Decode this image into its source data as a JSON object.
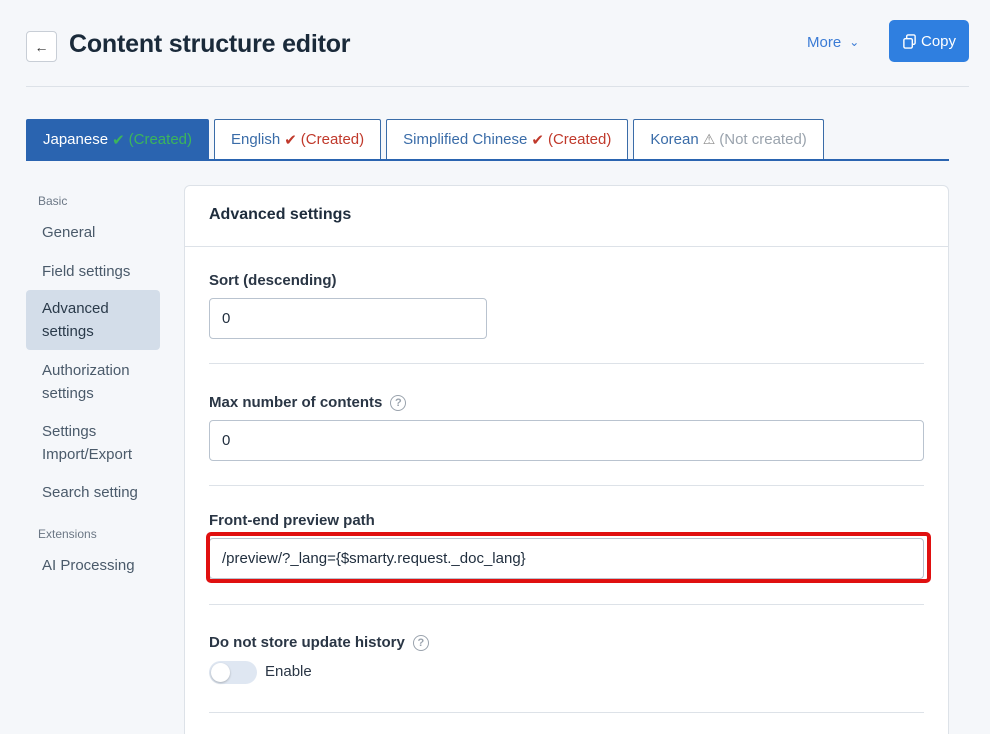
{
  "header": {
    "back_icon": "arrow-left-icon",
    "title": "Content structure editor",
    "more_label": "More",
    "copy_label": "Copy",
    "copy_icon": "copy-icon"
  },
  "tabs": [
    {
      "lang": "Japanese",
      "mark": "✔",
      "status": "(Created)",
      "active": true
    },
    {
      "lang": "English",
      "mark": "✔",
      "status": "(Created)",
      "active": false
    },
    {
      "lang": "Simplified Chinese",
      "mark": "✔",
      "status": "(Created)",
      "active": false
    },
    {
      "lang": "Korean",
      "mark": "⚠",
      "status": "(Not created)",
      "active": false
    }
  ],
  "sidebar": {
    "section_basic": "Basic",
    "items": [
      "General",
      "Field settings",
      "Advanced settings",
      "Authorization settings",
      "Settings Import/Export",
      "Search setting"
    ],
    "section_extensions": "Extensions",
    "ext_items": [
      "AI Processing"
    ]
  },
  "panel": {
    "title": "Advanced settings",
    "sort_label": "Sort (descending)",
    "sort_value": "0",
    "max_label": "Max number of contents",
    "max_value": "0",
    "preview_label": "Front-end preview path",
    "preview_value": "/preview/?_lang={$smarty.request._doc_lang}",
    "history_label": "Do not store update history",
    "toggle_label": "Enable"
  },
  "colors": {
    "accent": "#2a64b0",
    "copy_button": "#2f7fe0",
    "created_green": "#3cb55b",
    "created_red": "#c0392b",
    "highlight": "#e01010"
  }
}
